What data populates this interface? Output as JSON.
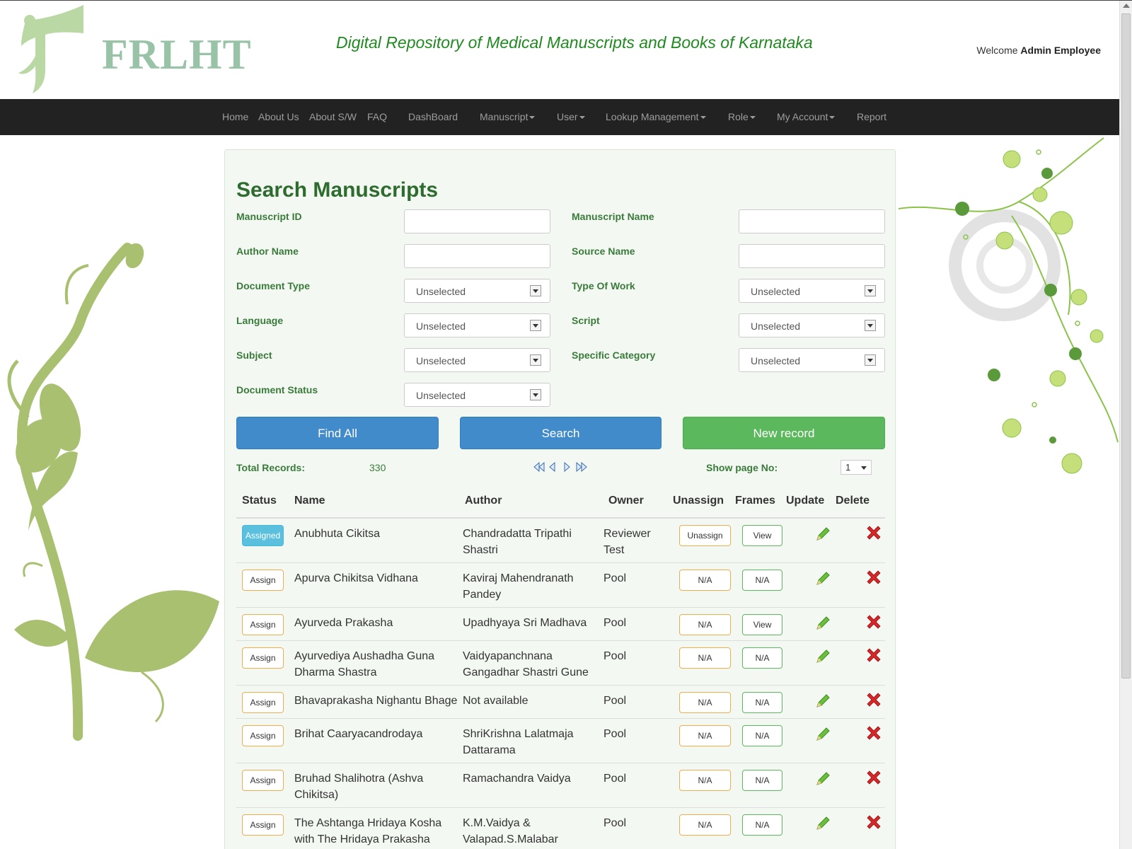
{
  "header": {
    "logo_text": "FRLHT",
    "site_title": "Digital Repository of Medical Manuscripts and Books of Karnataka",
    "welcome_prefix": "Welcome",
    "user_name": "Admin Employee"
  },
  "nav": {
    "items": [
      {
        "label": "Home",
        "dropdown": false
      },
      {
        "label": "About Us",
        "dropdown": false
      },
      {
        "label": "About S/W",
        "dropdown": false
      },
      {
        "label": "FAQ",
        "dropdown": false
      },
      {
        "label": "DashBoard",
        "dropdown": false
      },
      {
        "label": "Manuscript",
        "dropdown": true
      },
      {
        "label": "User",
        "dropdown": true
      },
      {
        "label": "Lookup Management",
        "dropdown": true
      },
      {
        "label": "Role",
        "dropdown": true
      },
      {
        "label": "My Account",
        "dropdown": true
      },
      {
        "label": "Report",
        "dropdown": false
      }
    ]
  },
  "search": {
    "title": "Search Manuscripts",
    "fields": {
      "manuscript_id": {
        "label": "Manuscript ID",
        "value": ""
      },
      "manuscript_name": {
        "label": "Manuscript Name",
        "value": ""
      },
      "author_name": {
        "label": "Author Name",
        "value": ""
      },
      "source_name": {
        "label": "Source Name",
        "value": ""
      },
      "document_type": {
        "label": "Document Type",
        "value": "Unselected"
      },
      "type_of_work": {
        "label": "Type Of Work",
        "value": "Unselected"
      },
      "language": {
        "label": "Language",
        "value": "Unselected"
      },
      "script": {
        "label": "Script",
        "value": "Unselected"
      },
      "subject": {
        "label": "Subject",
        "value": "Unselected"
      },
      "specific_category": {
        "label": "Specific Category",
        "value": "Unselected"
      },
      "document_status": {
        "label": "Document Status",
        "value": "Unselected"
      }
    },
    "buttons": {
      "find_all": "Find All",
      "search": "Search",
      "new_record": "New record"
    }
  },
  "results": {
    "total_label": "Total Records:",
    "total_value": "330",
    "page_label": "Show page No:",
    "page_value": "1",
    "columns": [
      "Status",
      "Name",
      "Author",
      "Owner",
      "Unassign",
      "Frames",
      "Update",
      "Delete"
    ],
    "rows": [
      {
        "status": "Assigned",
        "name": [
          "Anubhuta Cikitsa"
        ],
        "author": [
          "Chandradatta Tripathi",
          "Shastri"
        ],
        "owner": [
          "Reviewer",
          "Test"
        ],
        "unassign": "Unassign",
        "frames": "View"
      },
      {
        "status": "Assign",
        "name": [
          "Apurva Chikitsa Vidhana"
        ],
        "author": [
          "Kaviraj Mahendranath",
          "Pandey"
        ],
        "owner": [
          "Pool"
        ],
        "unassign": "N/A",
        "frames": "N/A"
      },
      {
        "status": "Assign",
        "name": [
          "Ayurveda Prakasha"
        ],
        "author": [
          "Upadhyaya Sri Madhava"
        ],
        "owner": [
          "Pool"
        ],
        "unassign": "N/A",
        "frames": "View"
      },
      {
        "status": "Assign",
        "name": [
          "Ayurvediya Aushadha Guna",
          "Dharma Shastra"
        ],
        "author": [
          "Vaidyapanchnana",
          "Gangadhar Shastri Gune"
        ],
        "owner": [
          "Pool"
        ],
        "unassign": "N/A",
        "frames": "N/A"
      },
      {
        "status": "Assign",
        "name": [
          "Bhavaprakasha Nighantu Bhage"
        ],
        "author": [
          "Not available"
        ],
        "owner": [
          "Pool"
        ],
        "unassign": "N/A",
        "frames": "N/A"
      },
      {
        "status": "Assign",
        "name": [
          "Brihat Caaryacandrodaya"
        ],
        "author": [
          "ShriKrishna Lalatmaja",
          "Dattarama"
        ],
        "owner": [
          "Pool"
        ],
        "unassign": "N/A",
        "frames": "N/A"
      },
      {
        "status": "Assign",
        "name": [
          "Bruhad Shalihotra (Ashva",
          "Chikitsa)"
        ],
        "author": [
          "Ramachandra Vaidya"
        ],
        "owner": [
          "Pool"
        ],
        "unassign": "N/A",
        "frames": "N/A"
      },
      {
        "status": "Assign",
        "name": [
          "The Ashtanga Hridaya Kosha",
          "with The Hridaya Prakasha"
        ],
        "author": [
          "K.M.Vaidya &",
          "Valapad.S.Malabar"
        ],
        "owner": [
          "Pool"
        ],
        "unassign": "N/A",
        "frames": "N/A"
      }
    ]
  },
  "colors": {
    "navbar_bg": "#222222",
    "title_green": "#1f8a1f",
    "label_green": "#3a7a3a",
    "panel_bg": "#f3f9f2",
    "btn_blue": "#428bca",
    "btn_green": "#5cb85c",
    "assigned_badge": "#5bc0de",
    "delete_red": "#d9262a"
  },
  "icons": {
    "edit": "pencil-icon",
    "delete": "red-x-icon",
    "pager": [
      "first-page-icon",
      "prev-page-icon",
      "next-page-icon",
      "last-page-icon"
    ]
  }
}
